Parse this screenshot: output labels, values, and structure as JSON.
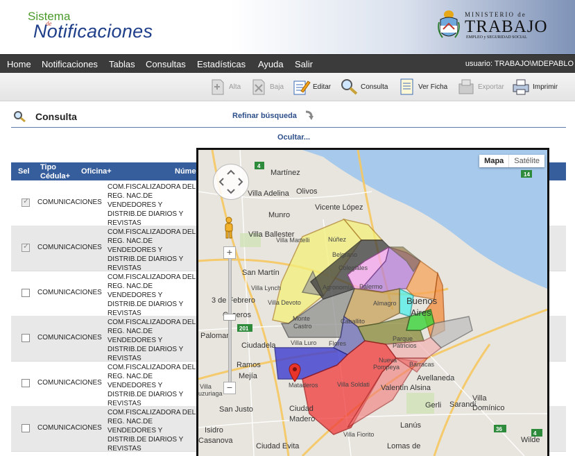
{
  "header": {
    "logo_sistema": "Sistema",
    "logo_de": "de",
    "logo_notificaciones": "Notificaciones",
    "ministerio_top": "MINISTERIO de",
    "ministerio_main": "TRABAJO",
    "ministerio_sub": "EMPLEO y SEGURIDAD SOCIAL"
  },
  "nav": {
    "items": [
      "Home",
      "Notificaciones",
      "Tablas",
      "Consultas",
      "Estadísticas",
      "Ayuda",
      "Salir"
    ],
    "user_label": "usuario:  TRABAJO\\MDEPABLO"
  },
  "toolbar": {
    "alta": "Alta",
    "baja": "Baja",
    "editar": "Editar",
    "consulta": "Consulta",
    "ver_ficha": "Ver Ficha",
    "exportar": "Exportar",
    "imprimir": "Imprimir"
  },
  "page": {
    "title": "Consulta",
    "refinar": "Refinar búsqueda",
    "ocultar": "Ocultar..."
  },
  "table": {
    "headers": {
      "sel": "Sel",
      "tipo_1": "Tipo",
      "tipo_2": "Cédula+",
      "oficina": "Oficina+",
      "numero": "Núme"
    },
    "rows": [
      {
        "checked": true,
        "tipo": "COMUNICACIONES",
        "oficina": "COM.FISCALIZADORA DEL REG. NAC.DE VENDEDORES Y DISTRIB.DE DIARIOS Y REVISTAS"
      },
      {
        "checked": true,
        "tipo": "COMUNICACIONES",
        "oficina": "COM.FISCALIZADORA DEL REG. NAC.DE VENDEDORES Y DISTRIB.DE DIARIOS Y REVISTAS"
      },
      {
        "checked": false,
        "tipo": "COMUNICACIONES",
        "oficina": "COM.FISCALIZADORA DEL REG. NAC.DE VENDEDORES Y DISTRIB.DE DIARIOS Y REVISTAS"
      },
      {
        "checked": false,
        "tipo": "COMUNICACIONES",
        "oficina": "COM.FISCALIZADORA DEL REG. NAC.DE VENDEDORES Y DISTRIB.DE DIARIOS Y REVISTAS"
      },
      {
        "checked": false,
        "tipo": "COMUNICACIONES",
        "oficina": "COM.FISCALIZADORA DEL REG. NAC.DE VENDEDORES Y DISTRIB.DE DIARIOS Y REVISTAS"
      },
      {
        "checked": false,
        "tipo": "COMUNICACIONES",
        "oficina": "COM.FISCALIZADORA DEL REG. NAC.DE VENDEDORES Y DISTRIB.DE DIARIOS Y REVISTAS"
      }
    ]
  },
  "map": {
    "type_map": "Mapa",
    "type_satellite": "Satélite",
    "zoom_plus": "+",
    "zoom_minus": "−",
    "labels": {
      "martinez": "Martínez",
      "villa_adelina": "Villa Adelina",
      "olivos": "Olivos",
      "vicente_lopez": "Vicente López",
      "munro": "Munro",
      "villa_ballester": "Villa Ballester",
      "villa_martelli": "Villa Martelli",
      "nunez": "Núñez",
      "belgrano": "Belgrano",
      "colegiales": "Colegiales",
      "san_martin": "San Martín",
      "villa_lynch": "Villa Lynch",
      "agronomia": "Agronomía",
      "palermo": "Palermo",
      "tres_de_febrero": "3 de Febrero",
      "villa_devoto": "Villa Devoto",
      "almagro": "Almagro",
      "buenos_aires": "Buenos Aires",
      "caseros": "Caseros",
      "monte_castro": "Monte Castro",
      "caballito": "Caballito",
      "palomar": "Palomar",
      "ciudadela": "Ciudadela",
      "villa_luro": "Villa Luro",
      "flores": "Flores",
      "parque_patricios": "Parque Patricios",
      "ramos_mejia": "Ramos Mejía",
      "nueva_pompeya": "Nueva Pompeya",
      "barracas": "Barracas",
      "avellaneda": "Avellaneda",
      "mataderos": "Mataderos",
      "villa_soldati": "Villa Soldati",
      "valentin_alsina": "Valentín Alsina",
      "villa_luzuriaga": "Villa Luzuriaga",
      "san_justo": "San Justo",
      "ciudad_madero": "Ciudad Madero",
      "gerli": "Gerli",
      "sarandi": "Sarandí",
      "villa_dominico": "Villa Domínico",
      "lanus": "Lanús",
      "isidro_casanova": "Isidro Casanova",
      "villa_fiorito": "Villa Fiorito",
      "ciudad_evita": "Ciudad Evita",
      "lomas_de_zamora": "Lomas de Zamora",
      "wilde": "Wilde",
      "route_4": "4",
      "route_201": "201",
      "route_14": "14",
      "route_36": "36"
    }
  }
}
